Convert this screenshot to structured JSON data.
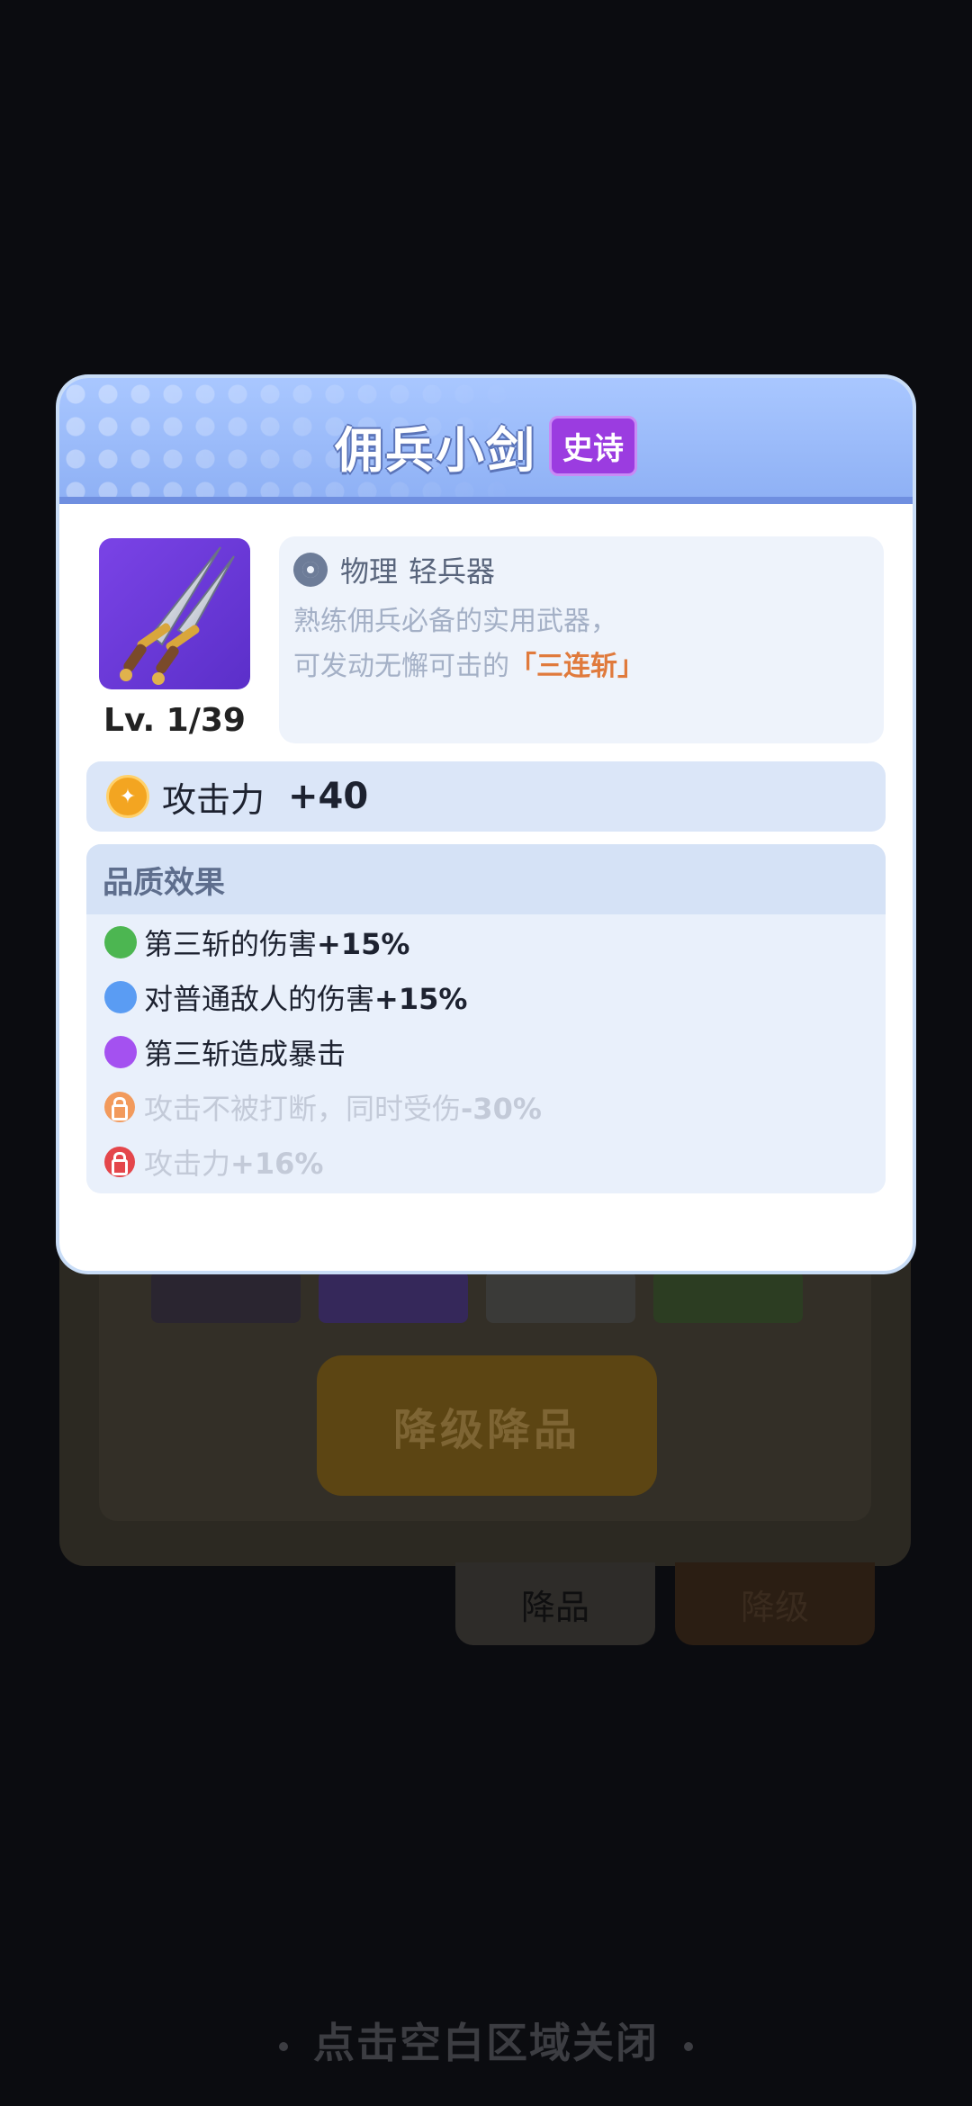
{
  "background": {
    "primary_button_label": "降级降品",
    "tabs": [
      {
        "label": "降品",
        "active": true
      },
      {
        "label": "降级",
        "active": false
      }
    ],
    "close_hint": "点击空白区域关闭"
  },
  "modal": {
    "title": "佣兵小剑",
    "rarity": "史诗",
    "item_icon": "twin-dagger-icon",
    "level": "Lv. 1/39",
    "damage_type": "物理",
    "weapon_class": "轻兵器",
    "description_line1": "熟练佣兵必备的实用武器，",
    "description_line2_prefix": "可发动无懈可击的",
    "skill_name": "「三连斩」",
    "stat": {
      "label": "攻击力",
      "value": "+40"
    },
    "quality_section_title": "品质效果",
    "quality_effects": [
      {
        "prefix": "第三斩的伤害",
        "value": "+15%",
        "color": "#4cb651",
        "locked": false
      },
      {
        "prefix": "对普通敌人的伤害",
        "value": "+15%",
        "color": "#5a9cf3",
        "locked": false
      },
      {
        "prefix": "第三斩造成暴击",
        "value": "",
        "color": "#a451f0",
        "locked": false
      },
      {
        "prefix": "攻击不被打断，同时受伤",
        "value": "-30%",
        "color": "#f29a5c",
        "locked": true
      },
      {
        "prefix": "攻击力",
        "value": "+16%",
        "color": "#e4464b",
        "locked": true
      }
    ]
  }
}
